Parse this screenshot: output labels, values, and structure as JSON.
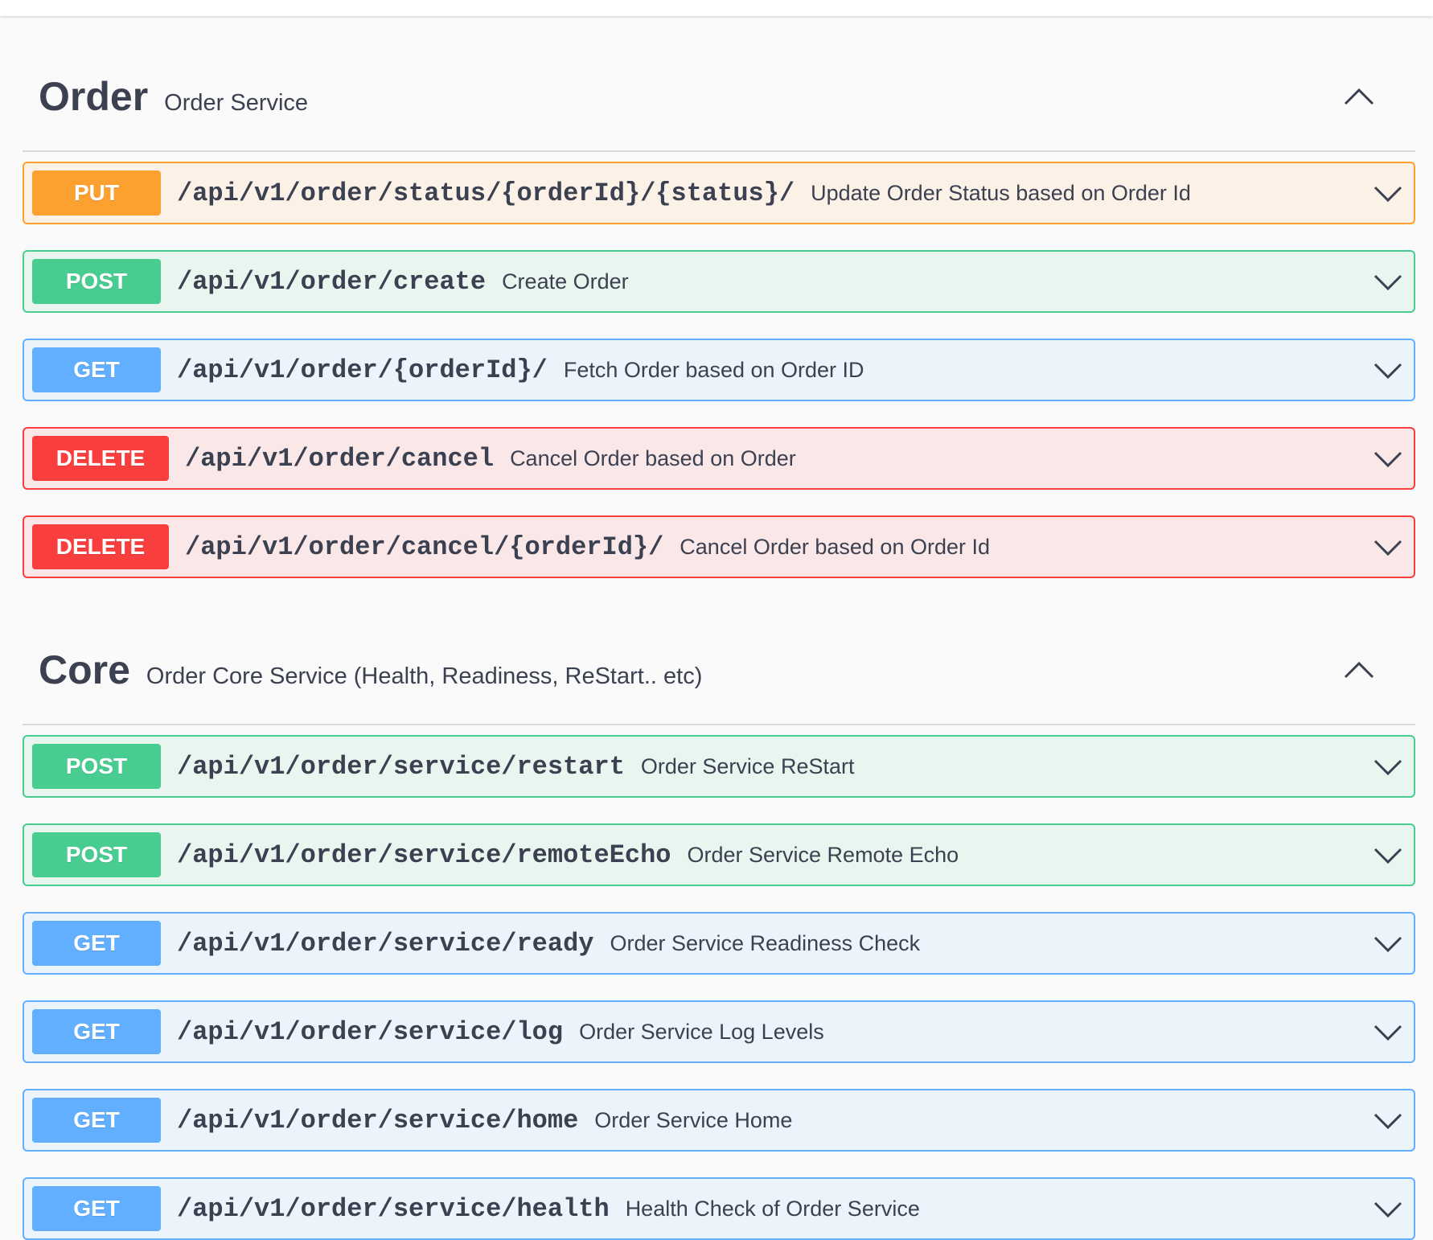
{
  "colors": {
    "put": "#fca130",
    "post": "#49cc90",
    "get": "#61affe",
    "delete": "#f93e3e",
    "text": "#3b4151",
    "background": "#fafafa"
  },
  "icons": {
    "tag_toggle": "chevron-up-icon",
    "op_toggle": "chevron-down-icon"
  },
  "sections": [
    {
      "name": "Order",
      "description": "Order Service",
      "operations": [
        {
          "method": "PUT",
          "path": "/api/v1/order/status/{orderId}/{status}/",
          "summary": "Update Order Status based on Order Id"
        },
        {
          "method": "POST",
          "path": "/api/v1/order/create",
          "summary": "Create Order"
        },
        {
          "method": "GET",
          "path": "/api/v1/order/{orderId}/",
          "summary": "Fetch Order based on Order ID"
        },
        {
          "method": "DELETE",
          "path": "/api/v1/order/cancel",
          "summary": "Cancel Order based on Order"
        },
        {
          "method": "DELETE",
          "path": "/api/v1/order/cancel/{orderId}/",
          "summary": "Cancel Order based on Order Id"
        }
      ]
    },
    {
      "name": "Core",
      "description": "Order Core Service (Health, Readiness, ReStart.. etc)",
      "operations": [
        {
          "method": "POST",
          "path": "/api/v1/order/service/restart",
          "summary": "Order Service ReStart"
        },
        {
          "method": "POST",
          "path": "/api/v1/order/service/remoteEcho",
          "summary": "Order Service Remote Echo"
        },
        {
          "method": "GET",
          "path": "/api/v1/order/service/ready",
          "summary": "Order Service Readiness Check"
        },
        {
          "method": "GET",
          "path": "/api/v1/order/service/log",
          "summary": "Order Service Log Levels"
        },
        {
          "method": "GET",
          "path": "/api/v1/order/service/home",
          "summary": "Order Service Home"
        },
        {
          "method": "GET",
          "path": "/api/v1/order/service/health",
          "summary": "Health Check of Order Service"
        }
      ]
    }
  ]
}
